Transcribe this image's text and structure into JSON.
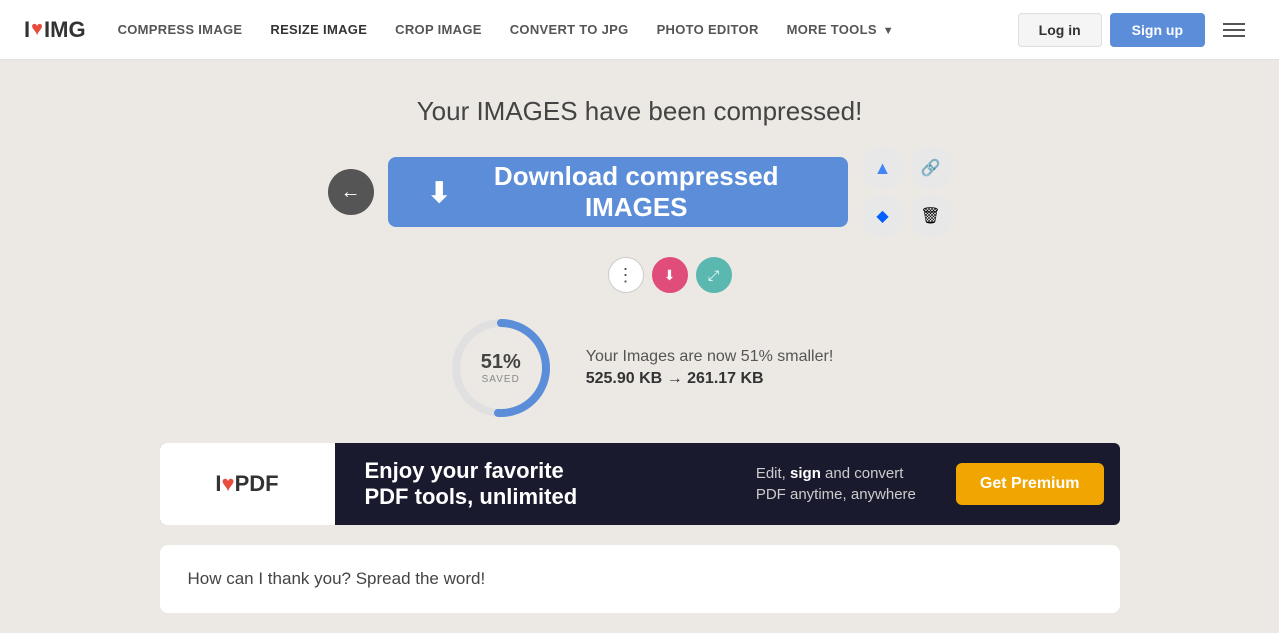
{
  "nav": {
    "logo": {
      "prefix": "I",
      "heart": "♥",
      "suffix": "IMG"
    },
    "links": [
      {
        "id": "compress",
        "label": "COMPRESS IMAGE"
      },
      {
        "id": "resize",
        "label": "RESIZE IMAGE"
      },
      {
        "id": "crop",
        "label": "CROP IMAGE"
      },
      {
        "id": "convert",
        "label": "CONVERT TO JPG"
      },
      {
        "id": "editor",
        "label": "PHOTO EDITOR"
      },
      {
        "id": "more",
        "label": "MORE TOOLS",
        "hasDropdown": true
      }
    ],
    "login_label": "Log in",
    "signup_label": "Sign up"
  },
  "main": {
    "title": "Your IMAGES have been compressed!",
    "download_button_label": "Download compressed IMAGES",
    "back_icon": "←",
    "download_icon": "⬇",
    "stats": {
      "percent": "51%",
      "saved_label": "SAVED",
      "description": "Your Images are now 51% smaller!",
      "size_info": "525.90 KB → 261.17 KB"
    },
    "mini_buttons": [
      {
        "id": "dots",
        "icon": "⋮",
        "style": "default"
      },
      {
        "id": "download-small",
        "icon": "⬇",
        "style": "pink"
      },
      {
        "id": "expand",
        "icon": "⤢",
        "style": "teal"
      }
    ],
    "action_buttons": [
      {
        "id": "google-drive",
        "icon": "▲",
        "label": "Upload to Google Drive"
      },
      {
        "id": "link",
        "icon": "🔗",
        "label": "Copy link"
      },
      {
        "id": "dropbox",
        "icon": "◆",
        "label": "Upload to Dropbox"
      },
      {
        "id": "trash",
        "icon": "🗑",
        "label": "Delete"
      }
    ]
  },
  "ad": {
    "logo_i": "I",
    "logo_heart": "♥",
    "logo_name": "PDF",
    "title_line1": "Enjoy your favorite",
    "title_line2": "PDF tools, unlimited",
    "subtitle_normal": "Edit, ",
    "subtitle_bold": "sign",
    "subtitle_after": " and convert",
    "subtitle_line2": "PDF anytime, anywhere",
    "cta_label": "Get Premium"
  },
  "spread": {
    "title": "How can I thank you? Spread the word!"
  }
}
